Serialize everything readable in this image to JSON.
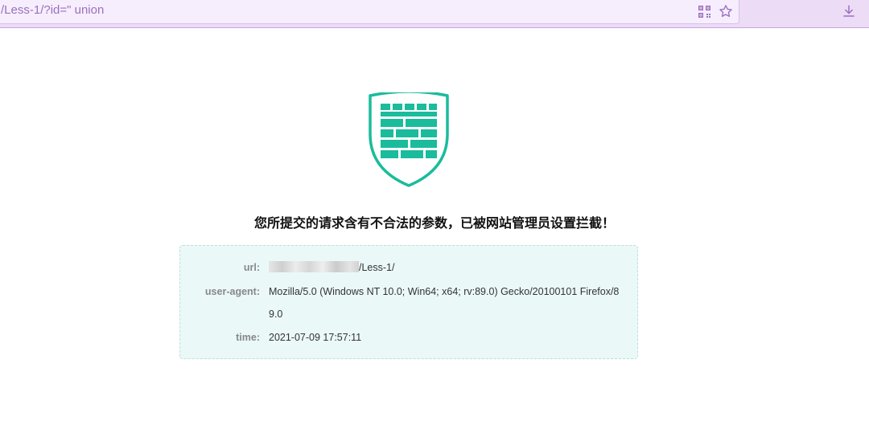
{
  "browser": {
    "url_text": "/Less-1/?id=\" union",
    "icons": [
      "qr-code-icon",
      "star-icon",
      "download-icon"
    ],
    "accent_color": "#9b6fc1"
  },
  "page": {
    "shield_color": "#1abc9c",
    "message": "您所提交的请求含有不合法的参数，已被网站管理员设置拦截！",
    "info": {
      "url_label": "url:",
      "url_value": "/Less-1/",
      "ua_label": "user-agent:",
      "ua_value": "Mozilla/5.0 (Windows NT 10.0; Win64; x64; rv:89.0) Gecko/20100101 Firefox/89.0",
      "time_label": "time:",
      "time_value": "2021-07-09 17:57:11"
    }
  }
}
